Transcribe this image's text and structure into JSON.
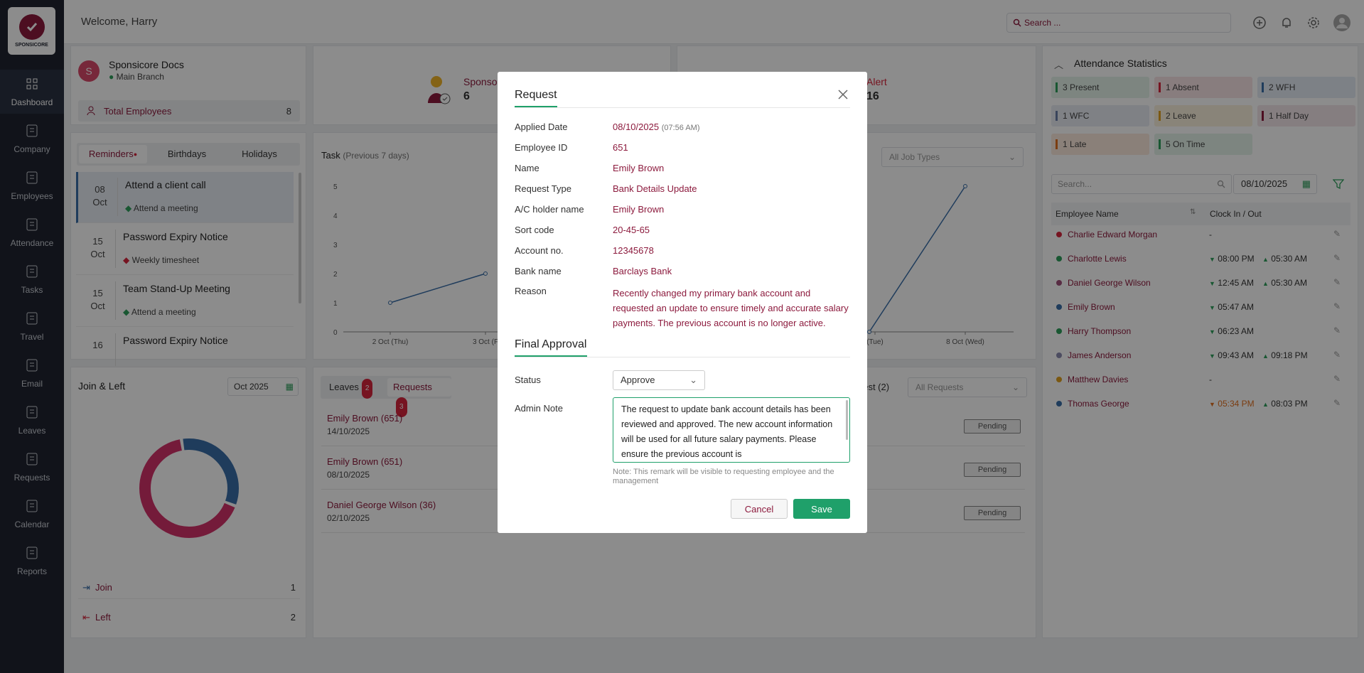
{
  "app": {
    "brand": "SPONSICORE",
    "welcome": "Welcome, Harry"
  },
  "search": {
    "placeholder": "Search ..."
  },
  "nav": [
    {
      "label": "Dashboard",
      "icon": "grid-icon"
    },
    {
      "label": "Company",
      "icon": "building-icon"
    },
    {
      "label": "Employees",
      "icon": "user-icon"
    },
    {
      "label": "Attendance",
      "icon": "attendance-icon"
    },
    {
      "label": "Tasks",
      "icon": "tasks-icon"
    },
    {
      "label": "Travel",
      "icon": "luggage-icon"
    },
    {
      "label": "Email",
      "icon": "mail-icon"
    },
    {
      "label": "Leaves",
      "icon": "leaf-icon"
    },
    {
      "label": "Requests",
      "icon": "edit-icon"
    },
    {
      "label": "Calendar",
      "icon": "calendar-icon"
    },
    {
      "label": "Reports",
      "icon": "report-icon"
    }
  ],
  "company": {
    "initial": "S",
    "name": "Sponsicore Docs",
    "branch": "Main Branch",
    "total_label": "Total Employees",
    "total": "8"
  },
  "sponsor": {
    "label": "Sponso",
    "count": "6"
  },
  "alert": {
    "label": "Alert",
    "count": "16"
  },
  "reminders": {
    "tabs": [
      "Reminders",
      "Birthdays",
      "Holidays"
    ],
    "items": [
      {
        "day": "08",
        "month": "Oct",
        "title": "Attend a client call",
        "sub": "Attend a meeting"
      },
      {
        "day": "15",
        "month": "Oct",
        "title": "Password Expiry Notice",
        "sub": "Weekly timesheet"
      },
      {
        "day": "15",
        "month": "Oct",
        "title": "Team Stand-Up Meeting",
        "sub": "Attend a meeting"
      },
      {
        "day": "16",
        "month": "",
        "title": "Password Expiry Notice",
        "sub": ""
      }
    ]
  },
  "task": {
    "title": "Task",
    "subtitle": "(Previous 7 days)",
    "job_filter": "All Job Types"
  },
  "chart_data": {
    "type": "line",
    "title": "Task",
    "ylim": [
      0,
      5
    ],
    "yticks": [
      "0",
      "1",
      "2",
      "3",
      "4",
      "5"
    ],
    "xticks": [
      "2 Oct (Thu)",
      "3 Oct (F",
      "(Tue)",
      "8 Oct (Wed)"
    ],
    "series": [
      {
        "x": [
          "2 Oct (Thu)",
          "3 Oct (Fri)"
        ],
        "values": [
          1,
          2
        ]
      },
      {
        "x": [
          "7 Oct (Tue)",
          "8 Oct (Wed)"
        ],
        "values": [
          0,
          5
        ]
      }
    ]
  },
  "join_left": {
    "title": "Join & Left",
    "month": "Oct 2025",
    "join_label": "Join",
    "join": "1",
    "left_label": "Left",
    "left": "2"
  },
  "donut_data": {
    "join": 1,
    "left": 2
  },
  "requests_panel": {
    "tab_leaves": "Leaves",
    "leaves_count": "2",
    "tab_requests": "Requests",
    "requests_count": "3",
    "right_tab": "uest (2)",
    "filter": "All Requests",
    "items": [
      {
        "name": "Emily Brown",
        "id": "(651)",
        "date": "14/10/2025",
        "status": "Pending"
      },
      {
        "name": "Emily Brown",
        "id": "(651)",
        "date": "08/10/2025",
        "status": "Pending"
      },
      {
        "name": "Daniel George Wilson",
        "id": "(36)",
        "date": "02/10/2025",
        "status": "Pending"
      }
    ]
  },
  "attendance": {
    "title": "Attendance Statistics",
    "stats": [
      {
        "n": "3",
        "label": "Present",
        "color": "#2e9e5b",
        "bg": "#e4f3ea"
      },
      {
        "n": "1",
        "label": "Absent",
        "color": "#d7263d",
        "bg": "#f8e4e6"
      },
      {
        "n": "2",
        "label": "WFH",
        "color": "#3a6ea8",
        "bg": "#e4ecf5"
      },
      {
        "n": "1",
        "label": "WFC",
        "color": "#6a7fa8",
        "bg": "#e8ecf3"
      },
      {
        "n": "2",
        "label": "Leave",
        "color": "#e0a020",
        "bg": "#faf0dc"
      },
      {
        "n": "1",
        "label": "Half Day",
        "color": "#8c1a3d",
        "bg": "#f2e6ea"
      },
      {
        "n": "1",
        "label": "Late",
        "color": "#e07020",
        "bg": "#fbe9dc"
      },
      {
        "n": "5",
        "label": "On Time",
        "color": "#2e9e5b",
        "bg": "#e4f3ea"
      }
    ],
    "search_placeholder": "Search...",
    "date": "08/10/2025",
    "col_name": "Employee Name",
    "col_clock": "Clock In / Out",
    "employees": [
      {
        "name": "Charlie Edward Morgan",
        "dot": "#d7263d",
        "in": "-",
        "out": ""
      },
      {
        "name": "Charlotte Lewis",
        "dot": "#2e9e5b",
        "in": "08:00 PM",
        "out": "05:30 AM"
      },
      {
        "name": "Daniel George Wilson",
        "dot": "#a0507a",
        "in": "12:45 AM",
        "out": "05:30 AM"
      },
      {
        "name": "Emily Brown",
        "dot": "#3a6ea8",
        "in": "05:47 AM",
        "out": ""
      },
      {
        "name": "Harry Thompson",
        "dot": "#2e9e5b",
        "in": "06:23 AM",
        "out": ""
      },
      {
        "name": "James Anderson",
        "dot": "#8a8ab0",
        "in": "09:43 AM",
        "out": "09:18 PM"
      },
      {
        "name": "Matthew Davies",
        "dot": "#e0a020",
        "in": "-",
        "out": ""
      },
      {
        "name": "Thomas George",
        "dot": "#3a6ea8",
        "in": "05:34 PM",
        "out": "08:03 PM",
        "late": true
      }
    ]
  },
  "modal": {
    "title": "Request",
    "fields": [
      {
        "label": "Applied Date",
        "value": "08/10/2025",
        "extra": "(07:56 AM)"
      },
      {
        "label": "Employee ID",
        "value": "651"
      },
      {
        "label": "Name",
        "value": "Emily Brown"
      },
      {
        "label": "Request Type",
        "value": "Bank Details Update"
      },
      {
        "label": "A/C holder name",
        "value": "Emily Brown"
      },
      {
        "label": "Sort code",
        "value": "20-45-65"
      },
      {
        "label": "Account no.",
        "value": "12345678"
      },
      {
        "label": "Bank name",
        "value": "Barclays Bank"
      }
    ],
    "reason_label": "Reason",
    "reason": "Recently changed my primary bank account and requested an update to ensure timely and accurate salary payments. The previous account is no longer active.",
    "final_title": "Final Approval",
    "status_label": "Status",
    "status_value": "Approve",
    "admin_label": "Admin Note",
    "admin_note": "The request to update bank account details has been reviewed and approved. The new account information will be used for all future salary payments. Please ensure the previous account is",
    "note": "Note: This remark will be visible to requesting employee and the management",
    "cancel": "Cancel",
    "save": "Save"
  }
}
